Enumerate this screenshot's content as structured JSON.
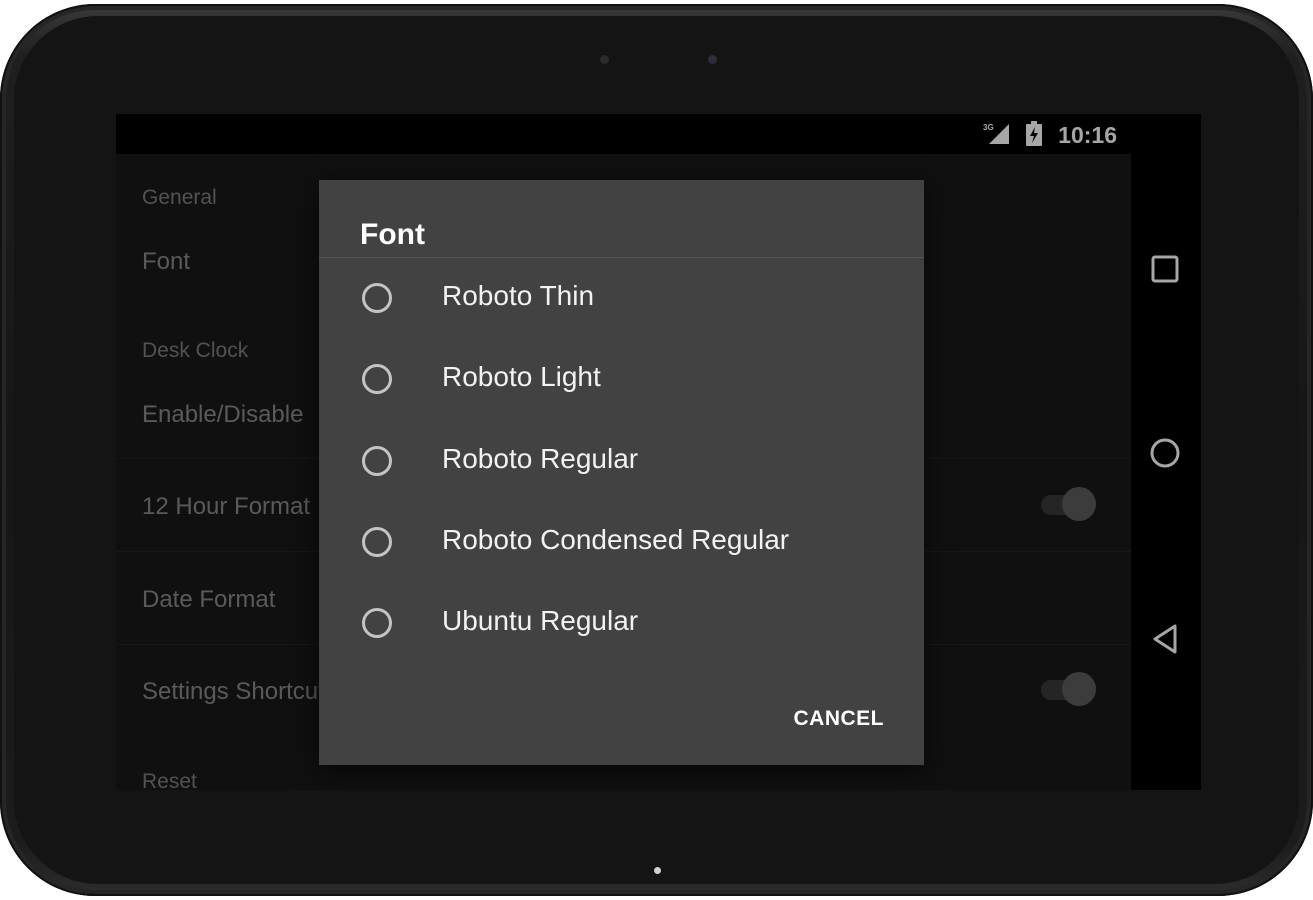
{
  "status_bar": {
    "time": "10:16",
    "network_label": "3G",
    "icons": [
      "signal-icon",
      "battery-icon"
    ]
  },
  "settings": {
    "general_header": "General",
    "font_label": "Font",
    "desk_clock_header": "Desk Clock",
    "enable_label": "Enable/Disable",
    "hour_format_label": "12 Hour Format",
    "hour_format_on": true,
    "date_format_label": "Date Format",
    "shortcut_label": "Settings Shortcut",
    "shortcut_on": true,
    "reset_header": "Reset"
  },
  "dialog": {
    "title": "Font",
    "options": [
      {
        "label": "Roboto Thin",
        "selected": false
      },
      {
        "label": "Roboto Light",
        "selected": false
      },
      {
        "label": "Roboto Regular",
        "selected": false
      },
      {
        "label": "Roboto Condensed Regular",
        "selected": false
      },
      {
        "label": "Ubuntu Regular",
        "selected": false
      }
    ],
    "cancel_label": "CANCEL"
  },
  "nav": {
    "icons": [
      "recents-icon",
      "home-icon",
      "back-icon"
    ]
  }
}
